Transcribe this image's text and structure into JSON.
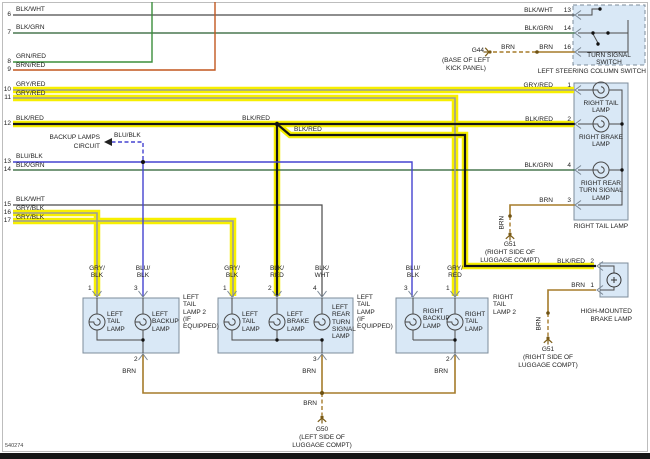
{
  "diagram_number": "540274",
  "highlight_color": "#f7ef00",
  "left_wires": [
    {
      "num": "6",
      "label": "BLK/WHT"
    },
    {
      "num": "7",
      "label": "BLK/GRN"
    },
    {
      "num": "8",
      "label": "GRN/RED"
    },
    {
      "num": "9",
      "label": "BRN/RED"
    },
    {
      "num": "10",
      "label": "GRY/RED"
    },
    {
      "num": "11",
      "label": "GRY/RED"
    },
    {
      "num": "12",
      "label": "BLK/RED"
    },
    {
      "num": "13",
      "label": "BLU/BLK"
    },
    {
      "num": "14",
      "label": "BLK/GRN"
    },
    {
      "num": "15",
      "label": "BLK/WHT"
    },
    {
      "num": "16",
      "label": "GRY/BLK"
    },
    {
      "num": "17",
      "label": "GRY/BLK"
    }
  ],
  "center_labels": {
    "backup_lamps_line1": "BACKUP LAMPS",
    "backup_lamps_line2": "CIRCUIT",
    "blu_blk": "BLU/BLK",
    "blk_red_junction": "BLK/RED",
    "blk_red_branch": "BLK/RED"
  },
  "turn_signal_switch": {
    "pins": [
      {
        "label": "BLK/WHT",
        "num": "13"
      },
      {
        "label": "BLK/GRN",
        "num": "14"
      },
      {
        "label": "BRN",
        "num": "16"
      }
    ],
    "title_line1": "TURN SIGNAL",
    "title_line2": "SWITCH",
    "subtitle": "LEFT STEERING COLUMN SWITCH"
  },
  "g44": {
    "wire_label_1": "BRN",
    "wire_label_2": "BRN",
    "name": "G44",
    "location_line1": "(BASE OF LEFT",
    "location_line2": "KICK PANEL)"
  },
  "right_tail_lamp": {
    "pins": [
      {
        "label": "GRY/RED",
        "num": "1"
      },
      {
        "label": "BLK/RED",
        "num": "2"
      },
      {
        "label": "BLK/GRN",
        "num": "4"
      },
      {
        "label": "BRN",
        "num": "3"
      }
    ],
    "bulbs": [
      "RIGHT TAIL LAMP",
      "RIGHT BRAKE LAMP",
      "RIGHT REAR TURN SIGNAL LAMP"
    ],
    "name": "RIGHT TAIL LAMP"
  },
  "g51_upper": {
    "wire": "BRN",
    "name": "G51",
    "location_line1": "(RIGHT SIDE OF",
    "location_line2": "LUGGAGE COMPT)"
  },
  "high_mounted_brake_lamp": {
    "pins": [
      {
        "label": "BLK/RED",
        "num": "2"
      },
      {
        "label": "BRN",
        "num": "1"
      }
    ],
    "name_line1": "HIGH-MOUNTED",
    "name_line2": "BRAKE LAMP"
  },
  "g51_lower": {
    "wire": "BRN",
    "name": "G51",
    "location_line1": "(RIGHT SIDE OF",
    "location_line2": "LUGGAGE COMPT)"
  },
  "left_tail_lamp_2": {
    "top_pins": [
      {
        "label": "GRY/ BLK",
        "num": "1"
      },
      {
        "label": "BLU/ BLK",
        "num": "3"
      }
    ],
    "bulbs": [
      "LEFT TAIL LAMP",
      "LEFT BACKUP LAMP"
    ],
    "name": "LEFT TAIL LAMP 2 (IF EQUIPPED)",
    "bottom_pin_num": "2",
    "bottom_wire": "BRN"
  },
  "left_tail_lamp": {
    "top_pins": [
      {
        "label": "GRY/ BLK",
        "num": "1"
      },
      {
        "label": "BLK/ RED",
        "num": "2"
      },
      {
        "label": "BLK/ WHT",
        "num": "4"
      }
    ],
    "bulbs": [
      "LEFT TAIL LAMP",
      "LEFT BRAKE LAMP",
      "LEFT REAR TURN SIGNAL LAMP"
    ],
    "name": "LEFT TAIL LAMP (IF EQUIPPED)",
    "bottom_pin_num": "3",
    "bottom_wire": "BRN"
  },
  "right_tail_lamp_2": {
    "top_pins": [
      {
        "label": "BLU/ BLK",
        "num": "3"
      },
      {
        "label": "GRY/ RED",
        "num": "1"
      }
    ],
    "bulbs": [
      "RIGHT BACKUP LAMP",
      "RIGHT TAIL LAMP"
    ],
    "name": "RIGHT TAIL LAMP 2",
    "bottom_pin_num": "2",
    "bottom_wire": "BRN"
  },
  "g50": {
    "wire": "BRN",
    "name": "G50",
    "location_line1": "(LEFT SIDE OF",
    "location_line2": "LUGGAGE COMPT)"
  }
}
